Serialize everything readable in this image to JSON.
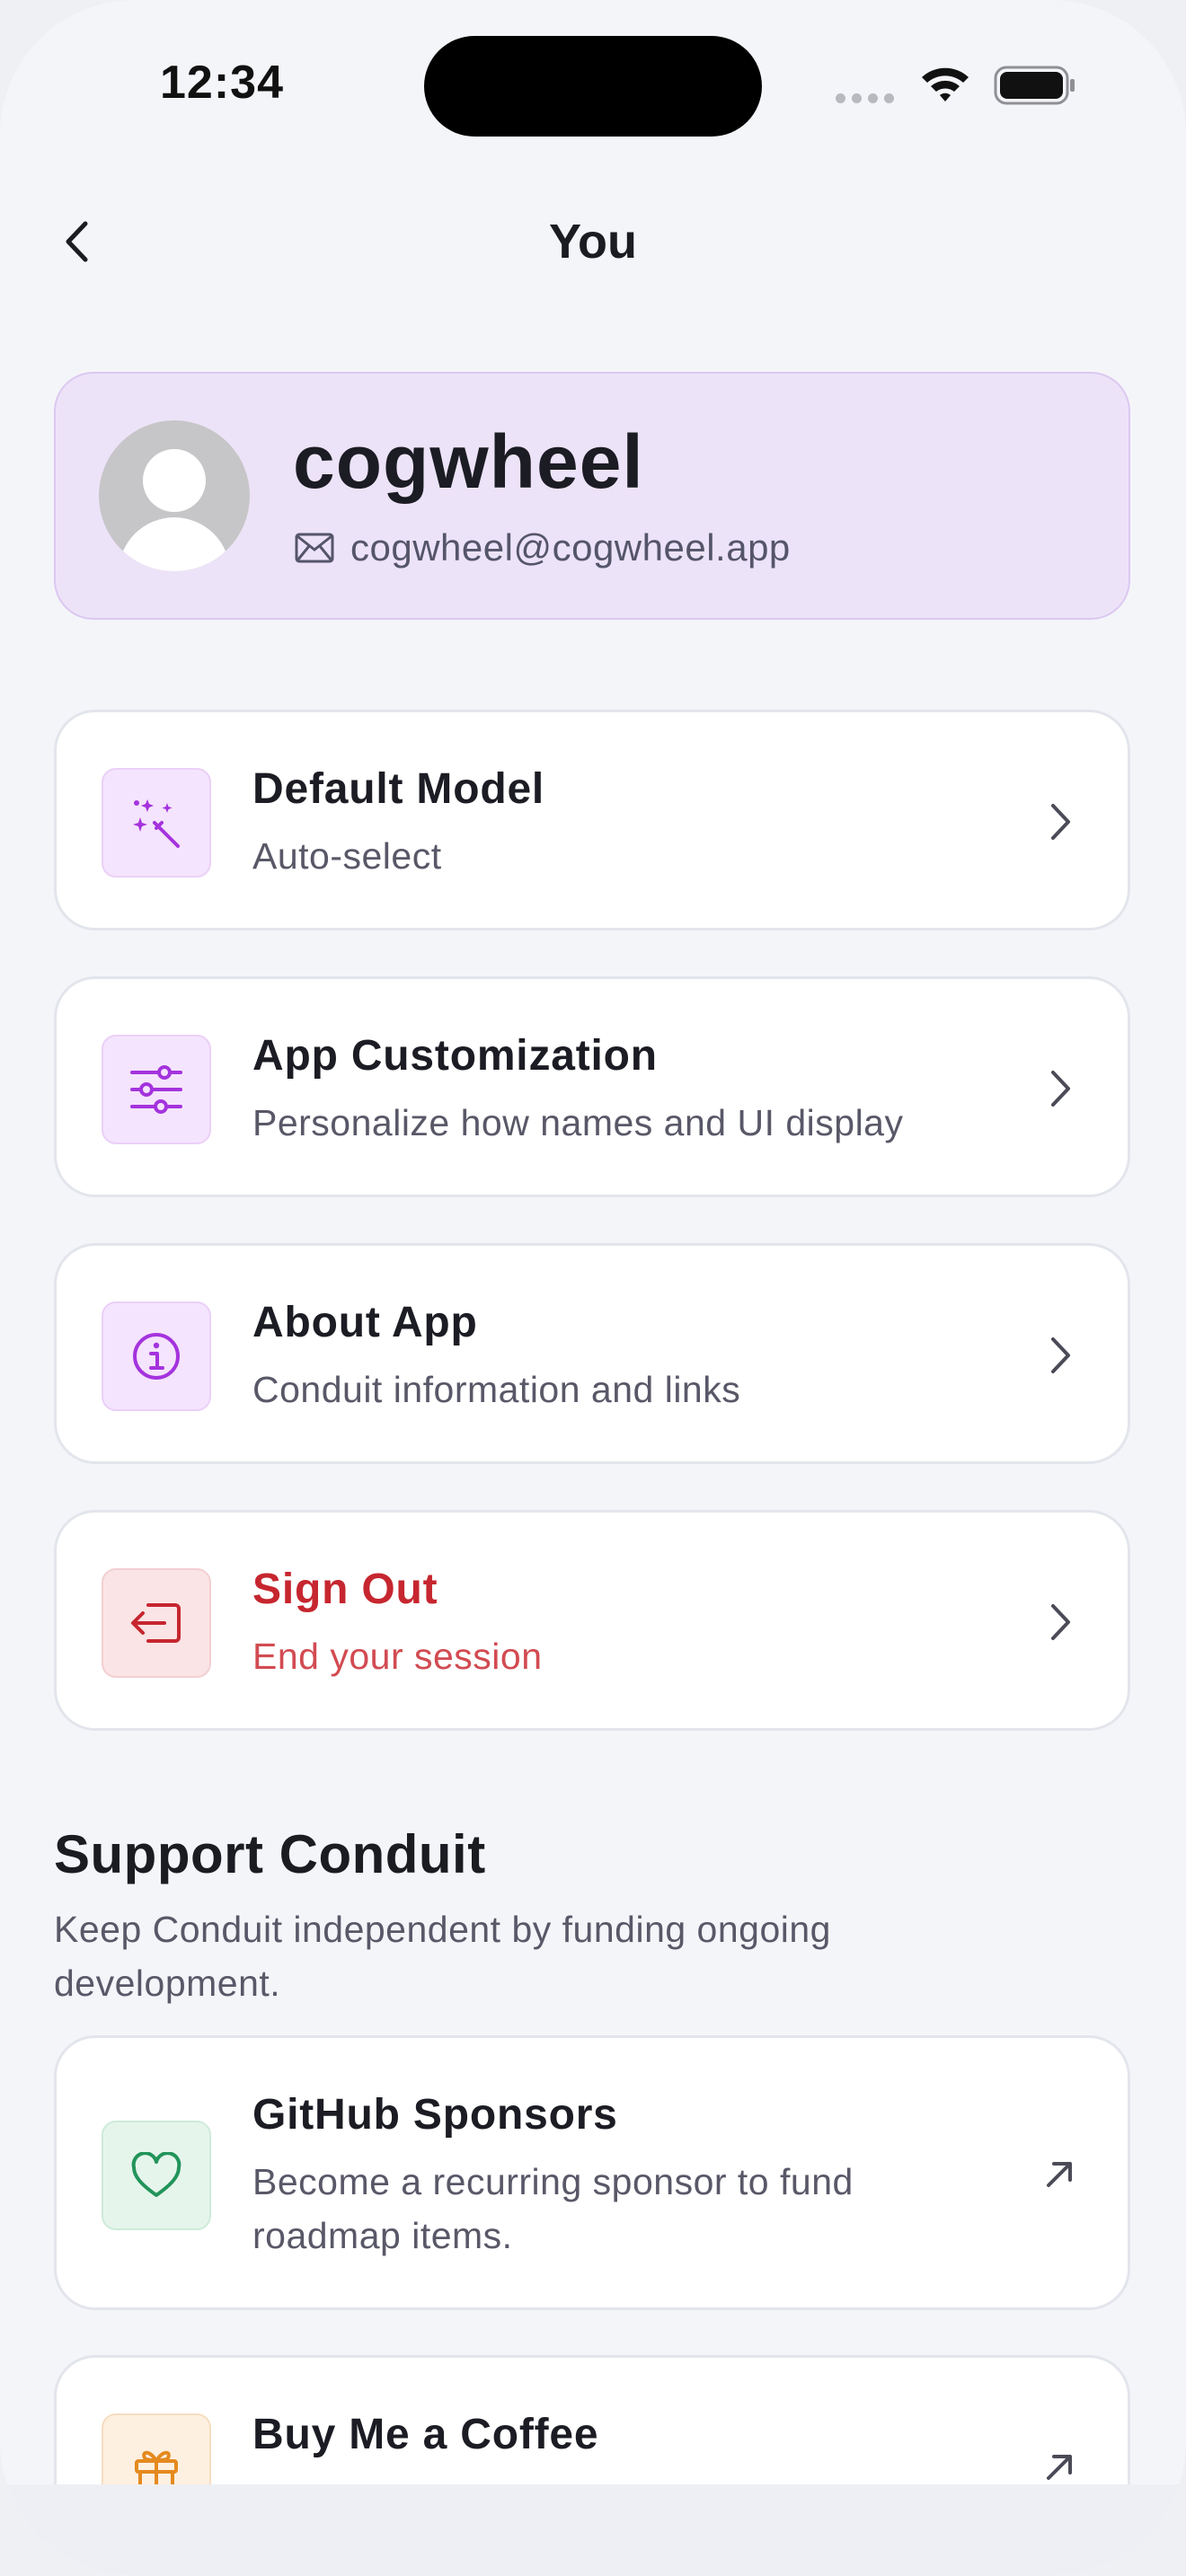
{
  "status_bar": {
    "time": "12:34"
  },
  "nav": {
    "title": "You"
  },
  "profile": {
    "name": "cogwheel",
    "email": "cogwheel@cogwheel.app"
  },
  "settings": [
    {
      "title": "Default Model",
      "subtitle": "Auto-select",
      "icon": "magic-wand-icon"
    },
    {
      "title": "App Customization",
      "subtitle": "Personalize how names and UI display",
      "icon": "sliders-icon"
    },
    {
      "title": "About App",
      "subtitle": "Conduit information and links",
      "icon": "info-icon"
    },
    {
      "title": "Sign Out",
      "subtitle": "End your session",
      "icon": "sign-out-icon"
    }
  ],
  "support": {
    "title": "Support Conduit",
    "description": "Keep Conduit independent by funding ongoing development.",
    "items": [
      {
        "title": "GitHub Sponsors",
        "subtitle": "Become a recurring sponsor to fund roadmap items.",
        "icon": "heart-icon"
      },
      {
        "title": "Buy Me a Coffee",
        "subtitle": "",
        "icon": "gift-icon"
      }
    ]
  },
  "colors": {
    "accent": "#9b30d9",
    "danger": "#c6262f",
    "success": "#22945a",
    "warning": "#e58a1f",
    "profile_bg": "#ede3f8"
  }
}
